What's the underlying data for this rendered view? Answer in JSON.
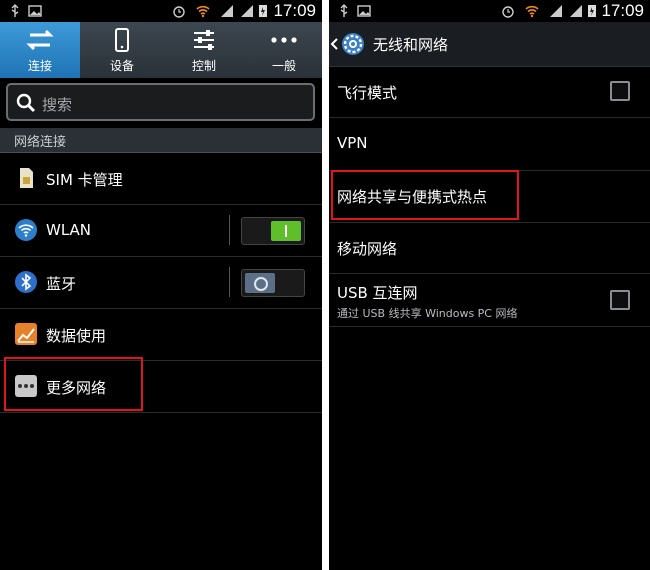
{
  "status_bar": {
    "time": "17:09"
  },
  "left": {
    "tabs": [
      {
        "label": "连接",
        "icon": "swap-arrows-icon",
        "active": true
      },
      {
        "label": "设备",
        "icon": "phone-icon",
        "active": false
      },
      {
        "label": "控制",
        "icon": "sliders-icon",
        "active": false
      },
      {
        "label": "一般",
        "icon": "more-dots-icon",
        "active": false
      }
    ],
    "search": {
      "placeholder": "搜索"
    },
    "section_title": "网络连接",
    "items": [
      {
        "label": "SIM 卡管理",
        "icon": "sim-card-icon"
      },
      {
        "label": "WLAN",
        "icon": "wifi-icon",
        "switch": "on"
      },
      {
        "label": "蓝牙",
        "icon": "bluetooth-icon",
        "switch": "off"
      },
      {
        "label": "数据使用",
        "icon": "data-usage-icon"
      },
      {
        "label": "更多网络",
        "icon": "more-networks-icon"
      }
    ]
  },
  "right": {
    "title": "无线和网络",
    "items": [
      {
        "label": "飞行模式",
        "checkbox": false
      },
      {
        "label": "VPN"
      },
      {
        "label": "网络共享与便携式热点"
      },
      {
        "label": "移动网络"
      },
      {
        "label": "USB 互连网",
        "sublabel": "通过 USB 线共享 Windows PC 网络",
        "checkbox": false
      }
    ]
  },
  "colors": {
    "accent": "#1f73b4",
    "highlight": "#e1141a",
    "switch_on": "#5fbf2a"
  }
}
